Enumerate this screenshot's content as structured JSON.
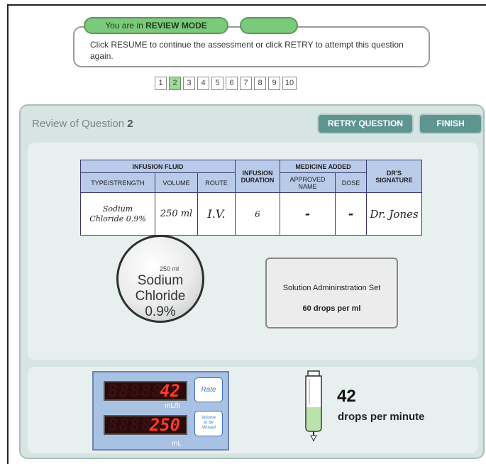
{
  "review_banner": {
    "mode_prefix": "You are in",
    "mode_name": "REVIEW MODE",
    "message": "Click RESUME to continue the assessment or click RETRY to attempt this question again."
  },
  "pager": {
    "pages": [
      "1",
      "2",
      "3",
      "4",
      "5",
      "6",
      "7",
      "8",
      "9",
      "10"
    ],
    "current": "2"
  },
  "review": {
    "title_prefix": "Review of Question",
    "question_number": "2",
    "retry_label": "RETRY QUESTION",
    "finish_label": "FINISH"
  },
  "prescription": {
    "headers": {
      "infusion_fluid": "INFUSION FLUID",
      "infusion_duration_1": "INFUSION",
      "infusion_duration_2": "DURATION",
      "medicine_added": "MEDICINE ADDED",
      "drs_signature_1": "DR'S",
      "drs_signature_2": "SIGNATURE",
      "type_strength": "TYPE/STRENGTH",
      "volume": "VOLUME",
      "route": "ROUTE",
      "approved_name_1": "APPROVED",
      "approved_name_2": "NAME",
      "dose": "DOSE"
    },
    "row": {
      "type_strength_1": "Sodium",
      "type_strength_2": "Chloride 0.9%",
      "volume": "250 ml",
      "route": "I.V.",
      "duration": "6",
      "approved_name": "-",
      "dose": "-",
      "signature": "Dr. Jones"
    }
  },
  "bag": {
    "volume": "250 ml",
    "name_line1": "Sodium",
    "name_line2": "Chloride",
    "name_line3": "0.9%"
  },
  "admin_set": {
    "title": "Solution Admininstration Set",
    "rate": "60 drops per ml"
  },
  "pump": {
    "rate_value": "42",
    "rate_ghost": "88888",
    "rate_unit": "mL/h",
    "rate_button": "Rate",
    "volume_value": "250",
    "volume_ghost": "88888",
    "volume_unit": "mL",
    "volume_button_line1": "Volume",
    "volume_button_line2": "to be",
    "volume_button_line3": "Infused"
  },
  "drip": {
    "drops_number": "42",
    "drops_label": "drops per minute",
    "fill_color": "#b9e3a9"
  },
  "colors": {
    "accent_button": "#5e9590",
    "pill_green": "#7bc97a",
    "led_red": "#ff3a2a",
    "table_header": "#b9cbe9"
  }
}
